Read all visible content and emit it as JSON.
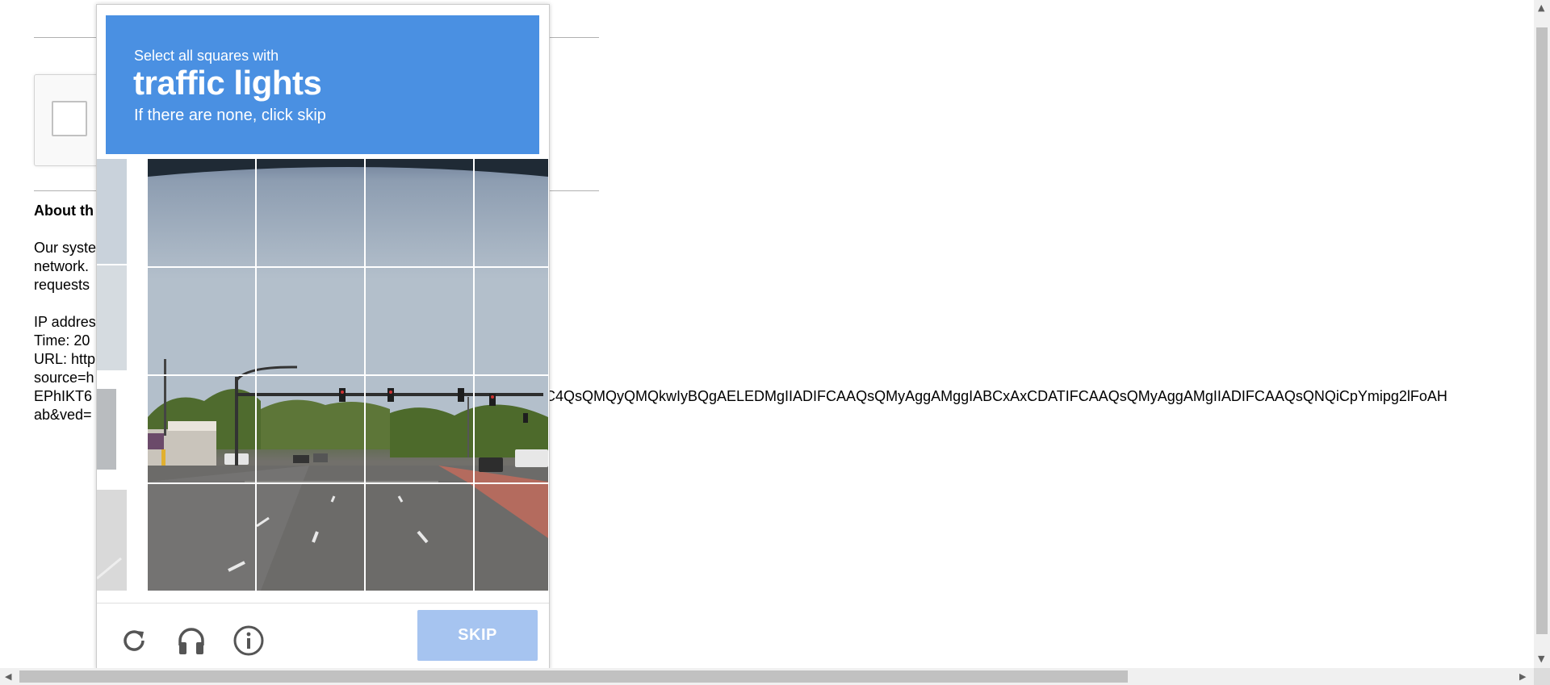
{
  "background": {
    "heading": "About th",
    "lines": [
      "Our syste",
      "network.",
      "requests",
      "",
      "IP addres",
      "Time: 20",
      "URL: http",
      "source=h",
      "EPhIKT6",
      "ab&ved="
    ],
    "url_tail": "C4QsQMQyQMQkwIyBQgAELEDMgIIADIFCAAQsQMyAggAMggIABCxAxCDATIFCAAQsQMyAggAMgIIADIFCAAQsQNQiCpYmipg2lFoAH"
  },
  "captcha": {
    "instruction": "Select all squares with",
    "target": "traffic lights",
    "hint": "If there are none, click skip",
    "skip_label": "SKIP",
    "grid_size": "4x4",
    "header_color": "#4a90e2",
    "skip_color": "#a6c4f0"
  },
  "icons": {
    "reload": "reload-icon",
    "audio": "headphones-icon",
    "info": "info-icon"
  }
}
